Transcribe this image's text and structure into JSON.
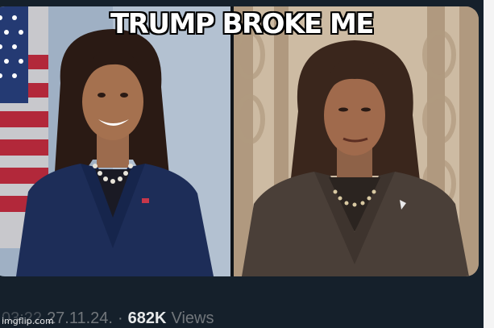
{
  "meme": {
    "caption": "TRUMP BROKE ME"
  },
  "tweet_meta": {
    "time": "03:22",
    "date": "27.11.24.",
    "separator": "·",
    "views_count": "682K",
    "views_label": "Views"
  },
  "watermark": "imgflip.com",
  "colors": {
    "background": "#15202b",
    "meta_text": "#71767b",
    "views_text": "#e7e9ea",
    "caption_text": "#ffffff"
  },
  "icons": [
    "us-flag",
    "brooch-pin"
  ]
}
